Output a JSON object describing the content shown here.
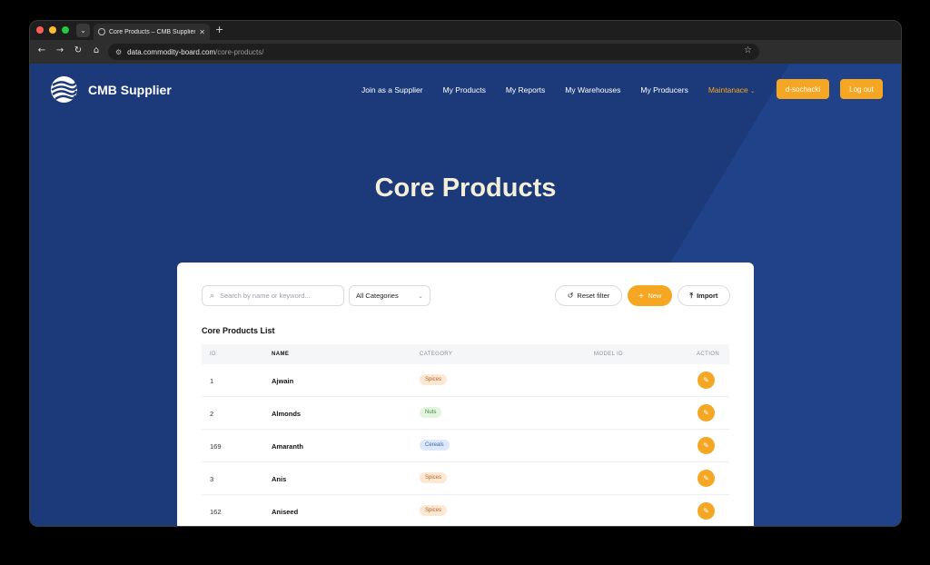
{
  "browser": {
    "tab_title": "Core Products – CMB Supplier",
    "url_host": "data.commodity-board.com",
    "url_path": "/core-products/"
  },
  "header": {
    "brand": "CMB Supplier",
    "nav": [
      {
        "label": "Join as a Supplier"
      },
      {
        "label": "My Products"
      },
      {
        "label": "My Reports"
      },
      {
        "label": "My Warehouses"
      },
      {
        "label": "My Producers"
      },
      {
        "label": "Maintanace"
      }
    ],
    "user_button": "d-sochacki",
    "logout_button": "Log out"
  },
  "hero": {
    "title": "Core Products"
  },
  "toolbar": {
    "search_placeholder": "Search by name or keyword...",
    "category_select": "All Categories",
    "reset_label": "Reset filter",
    "new_label": "New",
    "import_label": "Import"
  },
  "table": {
    "title": "Core Products List",
    "columns": {
      "id": "ID",
      "name": "NAME",
      "category": "CATEGORY",
      "model_id": "MODEL ID",
      "action": "ACTION"
    },
    "rows": [
      {
        "id": "1",
        "name": "Ajwain",
        "category": "Spices"
      },
      {
        "id": "2",
        "name": "Almonds",
        "category": "Nuts"
      },
      {
        "id": "169",
        "name": "Amaranth",
        "category": "Cereals"
      },
      {
        "id": "3",
        "name": "Anis",
        "category": "Spices"
      },
      {
        "id": "162",
        "name": "Aniseed",
        "category": "Spices"
      }
    ]
  },
  "colors": {
    "accent": "#f5a623",
    "page_bg": "#1c3a7a",
    "hero_text": "#f3efd9"
  }
}
